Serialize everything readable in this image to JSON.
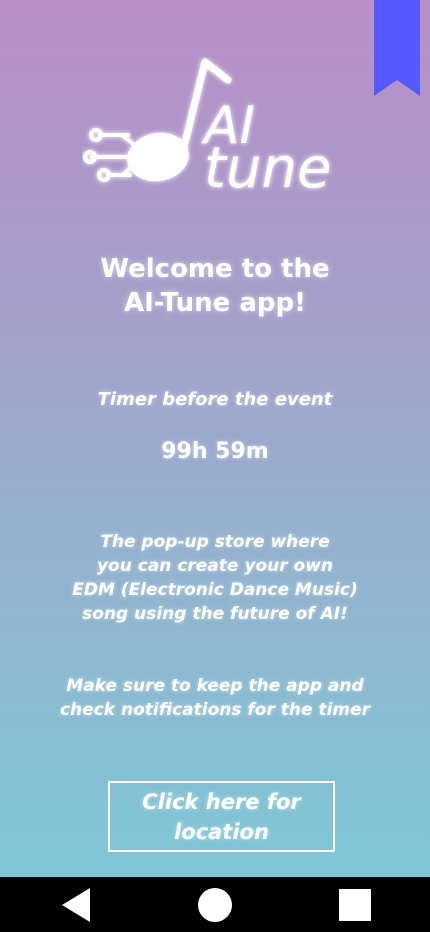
{
  "colors": {
    "gradient_top": "#b88fc8",
    "gradient_bottom": "#7ec6d6",
    "bookmark": "#5858ff",
    "navbar": "#000000",
    "text": "#ffffff"
  },
  "logo": {
    "line1": "AI",
    "line2": "tune"
  },
  "welcome": {
    "line1": "Welcome to the",
    "line2": "AI-Tune app!"
  },
  "timer": {
    "label": "Timer before the event",
    "value": "99h 59m"
  },
  "description": {
    "line1": "The pop-up store where",
    "line2": "you can create your own",
    "line3": "EDM (Electronic Dance Music)",
    "line4": "song using the future of AI!"
  },
  "note": {
    "line1": "Make sure to keep the app and",
    "line2": "check notifications for the timer"
  },
  "location_button": {
    "line1": "Click here for",
    "line2": "location"
  },
  "navbar": {
    "back_icon": "triangle-back-icon",
    "home_icon": "circle-home-icon",
    "recent_icon": "square-recents-icon"
  }
}
